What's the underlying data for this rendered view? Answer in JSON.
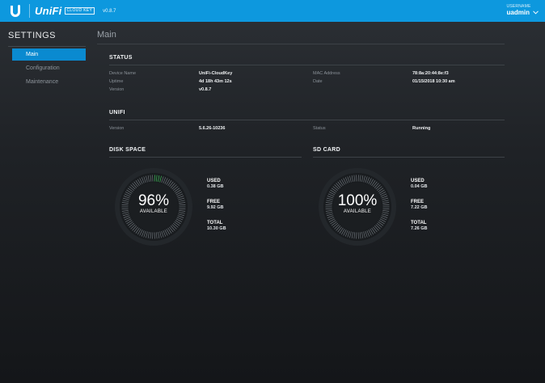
{
  "topbar": {
    "brand": "UniFi",
    "badge": "CLOUD KEY",
    "version": "v0.8.7",
    "username_label": "USERNAME",
    "username": "uadmin",
    "color": "#0d98de"
  },
  "sidebar": {
    "title": "SETTINGS",
    "items": [
      {
        "label": "Main",
        "active": true
      },
      {
        "label": "Configuration",
        "active": false
      },
      {
        "label": "Maintenance",
        "active": false
      }
    ]
  },
  "main": {
    "title": "Main",
    "status": {
      "heading": "STATUS",
      "rows": [
        {
          "label": "Device Name",
          "value": "UniFi-CloudKey"
        },
        {
          "label": "Uptime",
          "value": "4d 18h 43m 12s"
        },
        {
          "label": "Version",
          "value": "v0.8.7"
        }
      ],
      "rows_right": [
        {
          "label": "MAC Address",
          "value": "78:8a:20:44:8e:f3"
        },
        {
          "label": "Date",
          "value": "01/15/2018 10:30 am"
        }
      ]
    },
    "unifi": {
      "heading": "UNIFI",
      "version_label": "Version",
      "version_value": "5.6.26-10236",
      "status_label": "Status",
      "status_value": "Running"
    },
    "disk": {
      "heading": "DISK SPACE",
      "percent_text": "96%",
      "available_label": "AVAILABLE",
      "used_fraction": 0.04,
      "used_label": "USED",
      "used_value": "0.38 GB",
      "free_label": "FREE",
      "free_value": "9.92 GB",
      "total_label": "TOTAL",
      "total_value": "10.30 GB"
    },
    "sdcard": {
      "heading": "SD CARD",
      "percent_text": "100%",
      "available_label": "AVAILABLE",
      "used_fraction": 0.0,
      "used_label": "USED",
      "used_value": "0.04 GB",
      "free_label": "FREE",
      "free_value": "7.22 GB",
      "total_label": "TOTAL",
      "total_value": "7.26 GB"
    },
    "gauge_used_color": "#3fbf5a"
  }
}
